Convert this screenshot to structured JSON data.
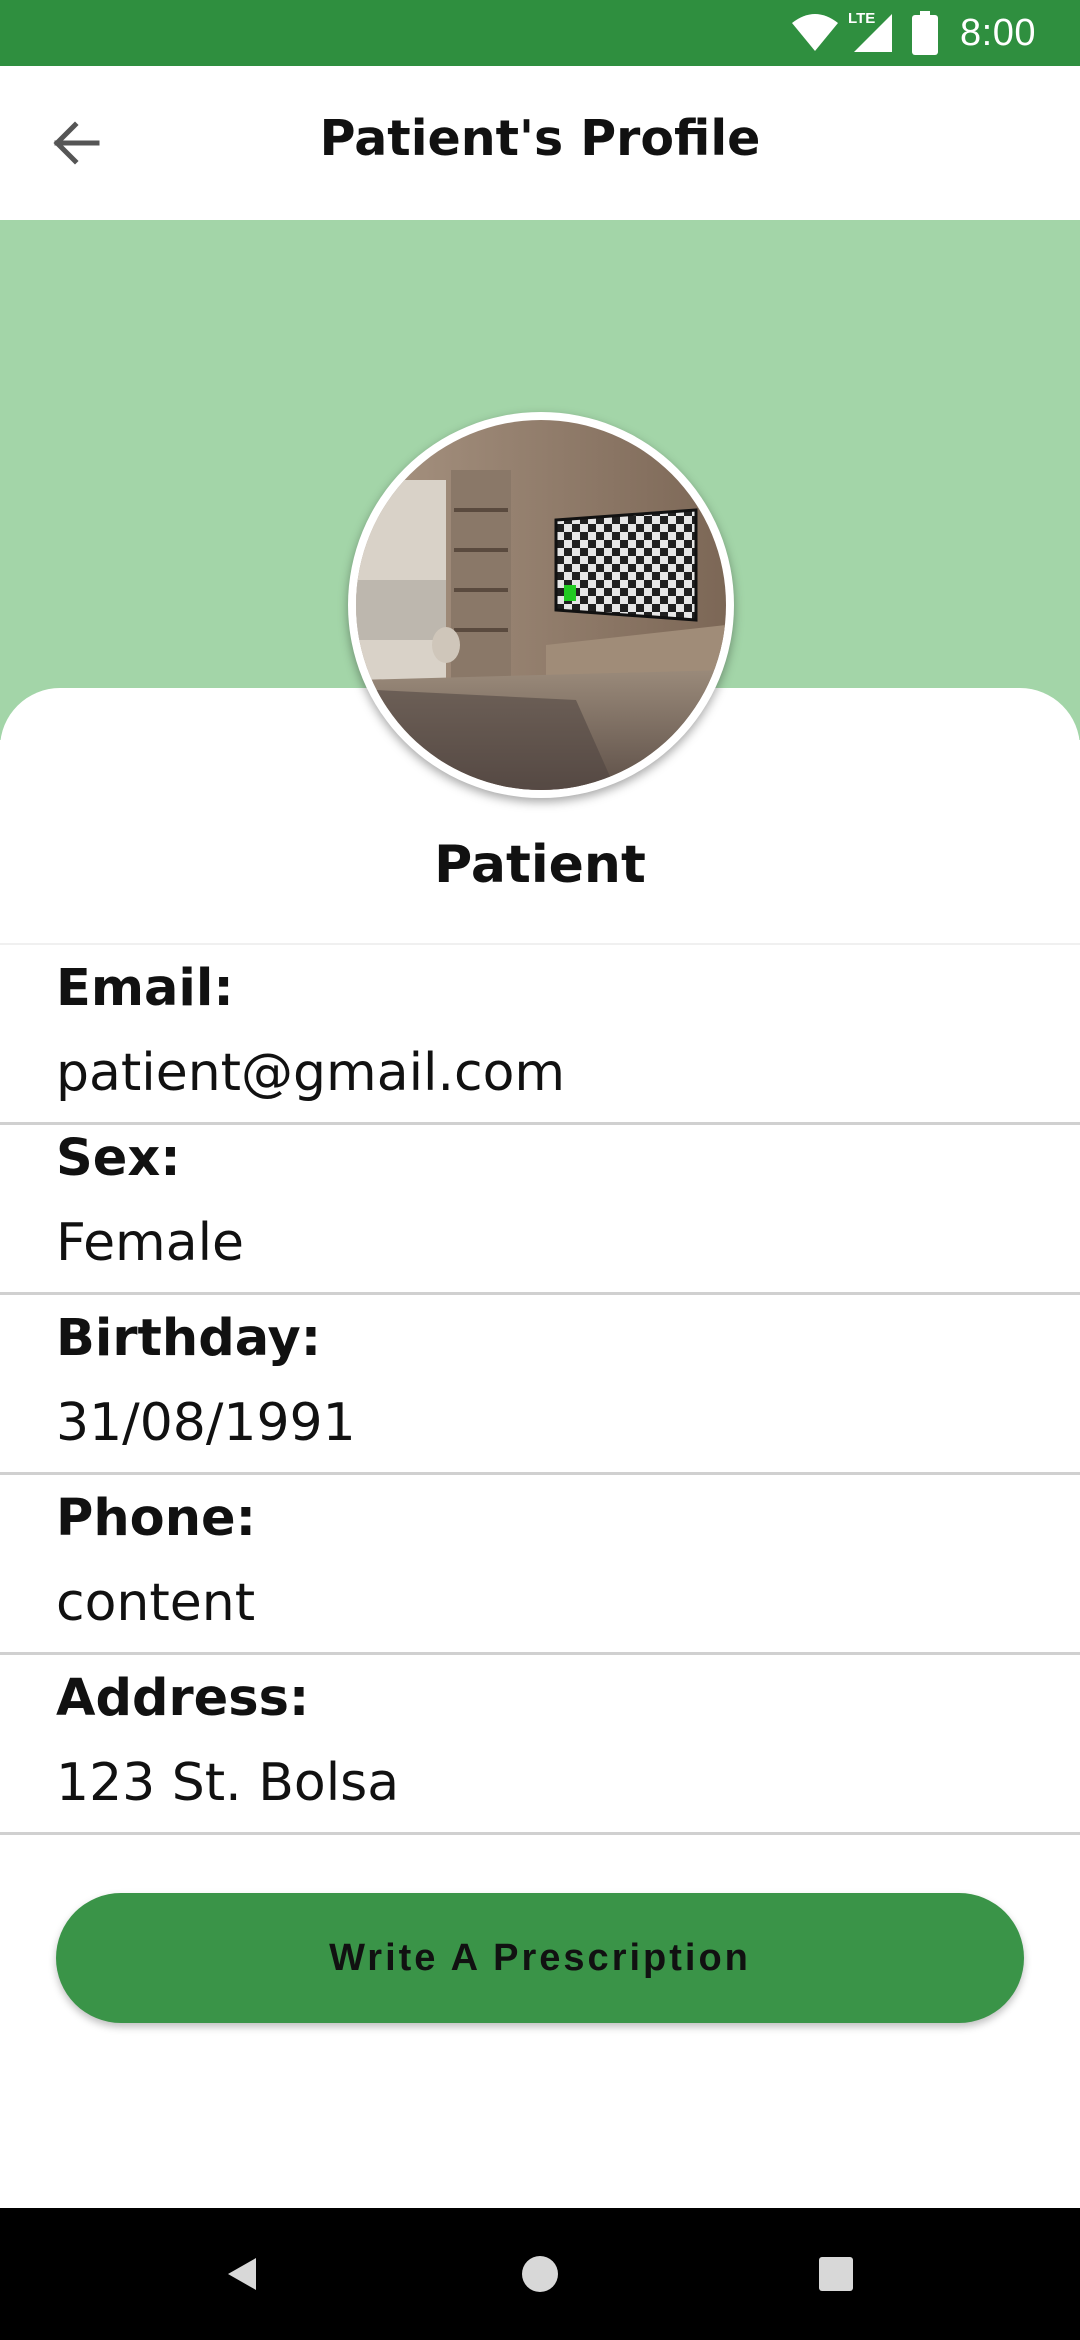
{
  "status_bar": {
    "time": "8:00",
    "network_label": "LTE",
    "icons": [
      "wifi-icon",
      "lte-signal-icon",
      "battery-icon"
    ]
  },
  "app_bar": {
    "title": "Patient's Profile",
    "back_icon": "arrow-left-icon"
  },
  "profile": {
    "name": "Patient",
    "avatar_icon": "profile-photo"
  },
  "fields": [
    {
      "label": "Email:",
      "value": "patient@gmail.com"
    },
    {
      "label": "Sex:",
      "value": "Female"
    },
    {
      "label": "Birthday:",
      "value": "31/08/1991"
    },
    {
      "label": "Phone:",
      "value": "content"
    },
    {
      "label": "Address:",
      "value": "123 St. Bolsa"
    }
  ],
  "actions": {
    "write_prescription_label": "Write A Prescription"
  },
  "nav_bar": {
    "icons": [
      "back-triangle-icon",
      "home-circle-icon",
      "recents-square-icon"
    ]
  },
  "colors": {
    "status_bar": "#2f8f3f",
    "header_band": "#a3d5a8",
    "button": "#3a9448",
    "nav_bar": "#000000"
  }
}
